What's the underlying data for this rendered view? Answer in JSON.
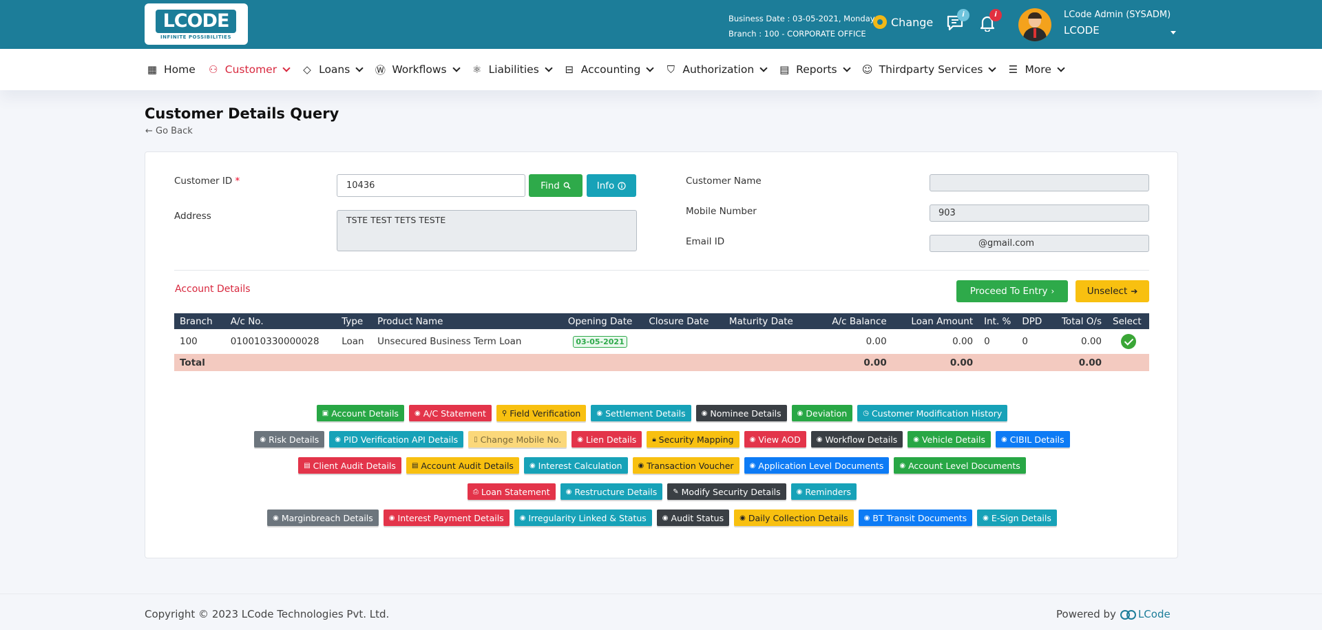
{
  "header": {
    "logo_text": "LCODE",
    "logo_tagline": "INFINITE POSSIBILITIES",
    "business_date": "Business Date : 03-05-2021, Monday",
    "branch": "Branch : 100 - CORPORATE OFFICE",
    "change_label": "Change",
    "messages_badge": "i",
    "notifications_badge": "i",
    "user_name": "LCode Admin (SYSADM)",
    "org_name": "LCODE",
    "colors": {
      "bar": "#1c7d99",
      "accent_yellow": "#f2b817"
    }
  },
  "nav": {
    "items": [
      {
        "label": "Home",
        "icon": "home-grid-icon",
        "glyph": "▦",
        "dropdown": false
      },
      {
        "label": "Customer",
        "icon": "user-icon",
        "glyph": "⚇",
        "dropdown": true
      },
      {
        "label": "Loans",
        "icon": "diamond-icon",
        "glyph": "◇",
        "dropdown": true
      },
      {
        "label": "Workflows",
        "icon": "workflow-icon",
        "glyph": "Ⓦ",
        "dropdown": true
      },
      {
        "label": "Liabilities",
        "icon": "atom-icon",
        "glyph": "⚛",
        "dropdown": true
      },
      {
        "label": "Accounting",
        "icon": "briefcase-icon",
        "glyph": "⊟",
        "dropdown": true
      },
      {
        "label": "Authorization",
        "icon": "shield-icon",
        "glyph": "⛉",
        "dropdown": true
      },
      {
        "label": "Reports",
        "icon": "report-icon",
        "glyph": "▤",
        "dropdown": true
      },
      {
        "label": "Thirdparty Services",
        "icon": "smile-icon",
        "glyph": "☺",
        "dropdown": true
      },
      {
        "label": "More",
        "icon": "more-list-icon",
        "glyph": "☰",
        "dropdown": true
      }
    ],
    "active": "Customer",
    "active_color": "#d8283e"
  },
  "page": {
    "title": "Customer Details Query",
    "go_back": "← Go Back"
  },
  "form": {
    "customer_id_label": "Customer ID",
    "required_mark": "*",
    "customer_id_value": "10436",
    "find_label": "Find",
    "info_label": "Info",
    "address_label": "Address",
    "address_value": "TSTE TEST TETS TESTE",
    "customer_name_label": "Customer Name",
    "customer_name_value": "",
    "mobile_label": "Mobile Number",
    "mobile_value": "903",
    "email_label": "Email ID",
    "email_value": "@gmail.com"
  },
  "accounts": {
    "title": "Account Details",
    "proceed_label": "Proceed To Entry",
    "unselect_label": "Unselect",
    "columns": [
      "Branch",
      "A/c No.",
      "Type",
      "Product Name",
      "Opening Date",
      "Closure Date",
      "Maturity Date",
      "A/c Balance",
      "Loan Amount",
      "Int. %",
      "DPD",
      "Total O/s",
      "Select"
    ],
    "rows": [
      {
        "branch": "100",
        "ac_no": "010010330000028",
        "type": "Loan",
        "product": "Unsecured Business Term Loan",
        "opening_date": "03-05-2021",
        "closure_date": "",
        "maturity_date": "",
        "balance": "0.00",
        "loan_amount": "0.00",
        "interest": "0",
        "dpd": "0",
        "total_os": "0.00",
        "selected": true
      }
    ],
    "total": {
      "label": "Total",
      "balance": "0.00",
      "loan_amount": "0.00",
      "total_os": "0.00"
    }
  },
  "actions": {
    "rows": [
      [
        {
          "label": "Account Details",
          "color": "green",
          "icon": "id-card-icon",
          "glyph": "▣"
        },
        {
          "label": "A/C Statement",
          "color": "red",
          "icon": "eye-icon",
          "glyph": "◉"
        },
        {
          "label": "Field Verification",
          "color": "yellow",
          "icon": "user-icon",
          "glyph": "⚲"
        },
        {
          "label": "Settlement Details",
          "color": "teal",
          "icon": "eye-icon",
          "glyph": "◉"
        },
        {
          "label": "Nominee Details",
          "color": "dark",
          "icon": "eye-icon",
          "glyph": "◉"
        },
        {
          "label": "Deviation",
          "color": "green",
          "icon": "eye-icon",
          "glyph": "◉"
        },
        {
          "label": "Customer Modification History",
          "color": "teal",
          "icon": "history-icon",
          "glyph": "◷"
        }
      ],
      [
        {
          "label": "Risk Details",
          "color": "gray",
          "icon": "eye-icon",
          "glyph": "◉"
        },
        {
          "label": "PID Verification API Details",
          "color": "teal",
          "icon": "eye-icon",
          "glyph": "◉"
        },
        {
          "label": "Change Mobile No.",
          "color": "paleyellow",
          "icon": "mobile-icon",
          "glyph": "▯"
        },
        {
          "label": "Lien Details",
          "color": "red",
          "icon": "eye-icon",
          "glyph": "◉"
        },
        {
          "label": "Security Mapping",
          "color": "yellow",
          "icon": "lock-icon",
          "glyph": "🔒︎"
        },
        {
          "label": "View AOD",
          "color": "red",
          "icon": "eye-icon",
          "glyph": "◉"
        },
        {
          "label": "Workflow Details",
          "color": "dark",
          "icon": "eye-icon",
          "glyph": "◉"
        },
        {
          "label": "Vehicle Details",
          "color": "green",
          "icon": "eye-icon",
          "glyph": "◉"
        },
        {
          "label": "CIBIL Details",
          "color": "blue",
          "icon": "eye-icon",
          "glyph": "◉"
        }
      ],
      [
        {
          "label": "Client Audit Details",
          "color": "red",
          "icon": "file-icon",
          "glyph": "▤"
        },
        {
          "label": "Account Audit Details",
          "color": "yellow",
          "icon": "file-icon",
          "glyph": "▤"
        },
        {
          "label": "Interest Calculation",
          "color": "teal",
          "icon": "eye-icon",
          "glyph": "◉"
        },
        {
          "label": "Transaction Voucher",
          "color": "yellow",
          "icon": "eye-icon",
          "glyph": "◉"
        },
        {
          "label": "Application Level Documents",
          "color": "blue",
          "icon": "eye-icon",
          "glyph": "◉"
        },
        {
          "label": "Account Level Documents",
          "color": "green",
          "icon": "eye-icon",
          "glyph": "◉"
        }
      ],
      [
        {
          "label": "Loan Statement",
          "color": "red",
          "icon": "print-icon",
          "glyph": "⎙"
        },
        {
          "label": "Restructure Details",
          "color": "teal",
          "icon": "eye-icon",
          "glyph": "◉"
        },
        {
          "label": "Modify Security Details",
          "color": "dark",
          "icon": "edit-icon",
          "glyph": "✎"
        },
        {
          "label": "Reminders",
          "color": "teal",
          "icon": "eye-icon",
          "glyph": "◉"
        }
      ],
      [
        {
          "label": "Marginbreach Details",
          "color": "gray",
          "icon": "eye-icon",
          "glyph": "◉"
        },
        {
          "label": "Interest Payment Details",
          "color": "red",
          "icon": "eye-icon",
          "glyph": "◉"
        },
        {
          "label": "Irregularity Linked & Status",
          "color": "teal",
          "icon": "eye-icon",
          "glyph": "◉"
        },
        {
          "label": "Audit Status",
          "color": "dark",
          "icon": "eye-icon",
          "glyph": "◉"
        },
        {
          "label": "Daily Collection Details",
          "color": "yellow",
          "icon": "eye-icon",
          "glyph": "◉"
        },
        {
          "label": "BT Transit Documents",
          "color": "blue",
          "icon": "eye-icon",
          "glyph": "◉"
        },
        {
          "label": "E-Sign Details",
          "color": "teal",
          "icon": "eye-icon",
          "glyph": "◉"
        }
      ]
    ]
  },
  "footer": {
    "copyright": "Copyright © 2023 LCode Technologies Pvt. Ltd.",
    "powered_by": "Powered by",
    "brand": "LCode"
  }
}
